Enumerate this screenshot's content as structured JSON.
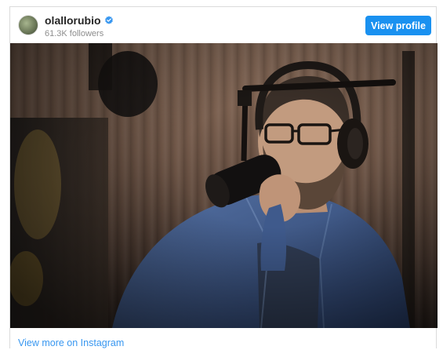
{
  "header": {
    "username": "olallorubio",
    "followers": "61.3K followers",
    "view_profile_label": "View profile"
  },
  "photo": {
    "alt": "Man with glasses and headphones speaking into a microphone in a podcast studio"
  },
  "footer": {
    "view_more_label": "View more on Instagram"
  },
  "colors": {
    "button": "#1a91f0",
    "link": "#3897f0",
    "verified_badge": "#3897f0"
  }
}
